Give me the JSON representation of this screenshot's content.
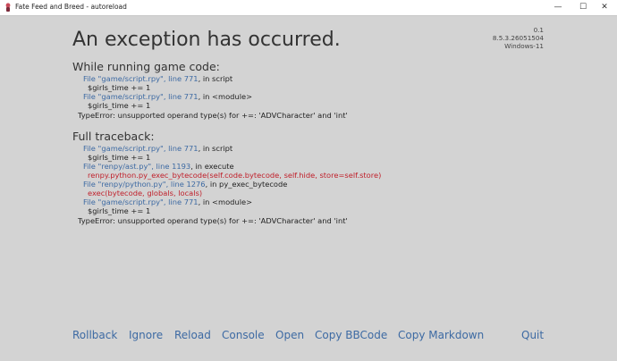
{
  "window": {
    "title": "Fate Feed and Breed - autoreload",
    "controls": {
      "minimize": "—",
      "maximize": "☐",
      "close": "✕"
    }
  },
  "error": {
    "heading": "An exception has occurred.",
    "version": [
      "0.1",
      "8.5.3.26051504",
      "Windows-11"
    ],
    "while_running": {
      "title": "While running game code:",
      "frames": [
        {
          "file": "File \"game/script.rpy\"",
          "line": ", line 771",
          "context": ", in script",
          "code": "$girls_time += 1"
        },
        {
          "file": "File \"game/script.rpy\"",
          "line": ", line 771",
          "context": ", in <module>",
          "code": "$girls_time += 1"
        }
      ],
      "error": "TypeError: unsupported operand type(s) for +=: 'ADVCharacter' and 'int'"
    },
    "full": {
      "title": "Full traceback:",
      "frames": [
        {
          "file": "File \"game/script.rpy\"",
          "line": ", line 771",
          "context": ", in script",
          "code": "$girls_time += 1"
        },
        {
          "file": "File \"renpy/ast.py\"",
          "line": ", line 1193",
          "context": ", in execute",
          "code": "renpy.python.py_exec_bytecode(self.code.bytecode, self.hide, store=self.store)"
        },
        {
          "file": "File \"renpy/python.py\"",
          "line": ", line 1276",
          "context": ", in py_exec_bytecode",
          "code": "exec(bytecode, globals, locals)"
        },
        {
          "file": "File \"game/script.rpy\"",
          "line": ", line 771",
          "context": ", in <module>",
          "code": "$girls_time += 1"
        }
      ],
      "error": "TypeError: unsupported operand type(s) for +=: 'ADVCharacter' and 'int'"
    }
  },
  "toolbar": {
    "rollback": "Rollback",
    "ignore": "Ignore",
    "reload": "Reload",
    "console": "Console",
    "open": "Open",
    "copy_bbcode": "Copy BBCode",
    "copy_markdown": "Copy Markdown",
    "quit": "Quit"
  },
  "colors": {
    "background": "#d3d3d3",
    "link": "#3d6aa3",
    "error_code": "#c0202b"
  }
}
